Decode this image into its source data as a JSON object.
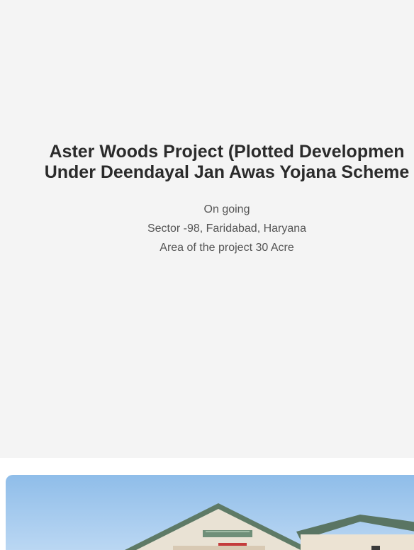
{
  "project": {
    "title_line1": "Aster Woods Project (Plotted Developmen",
    "title_line2": "Under Deendayal Jan Awas Yojana Scheme",
    "status": "On going",
    "location": "Sector -98, Faridabad, Haryana",
    "area": "Area of the project 30 Acre"
  },
  "image": {
    "subject": "residential-building-photo",
    "sky_color": "#a9cdf0",
    "roof_color": "#4f6a58",
    "wall_color": "#efe6d8"
  }
}
